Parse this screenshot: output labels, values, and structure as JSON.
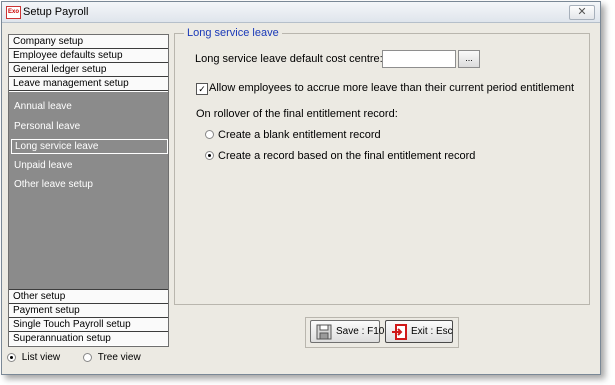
{
  "window": {
    "app_icon_text": "Exo",
    "title": "Setup Payroll",
    "close_symbol": "✕"
  },
  "nav": {
    "top_items": [
      "Company setup",
      "Employee defaults setup",
      "General ledger setup",
      "Leave management setup"
    ],
    "sub_items": [
      "Annual leave",
      "Personal leave",
      "Long service leave",
      "Unpaid leave",
      "Other leave setup"
    ],
    "selected_sub_item": "Long service leave",
    "bottom_items": [
      "Other setup",
      "Payment setup",
      "Single Touch Payroll setup",
      "Superannuation setup"
    ]
  },
  "view_options": {
    "list_label": "List view",
    "tree_label": "Tree view",
    "selected": "List view"
  },
  "form": {
    "section_title": "Long service leave",
    "cost_centre_label": "Long service leave default cost centre:",
    "cost_centre_value": "",
    "browse_label": "...",
    "accrue_checkbox_label": "Allow employees to accrue more leave than their current period entitlement",
    "accrue_checked": true,
    "rollover_heading": "On rollover of the final entitlement record:",
    "rollover_options": [
      "Create a blank entitlement record",
      "Create a record based on the final entitlement record"
    ],
    "rollover_selected": "Create a record based on the final entitlement record"
  },
  "buttons": {
    "save_label": "Save : F10",
    "exit_label": "Exit : Esc"
  },
  "icons": {
    "save": "save-disk-icon",
    "exit": "exit-door-icon",
    "app": "exo-app-icon",
    "close": "close-icon"
  },
  "colors": {
    "nav_panel": "#8b8b8b",
    "section_title": "#1a39b8",
    "exit_icon": "#d01818",
    "window_bg": "#eceae3"
  }
}
